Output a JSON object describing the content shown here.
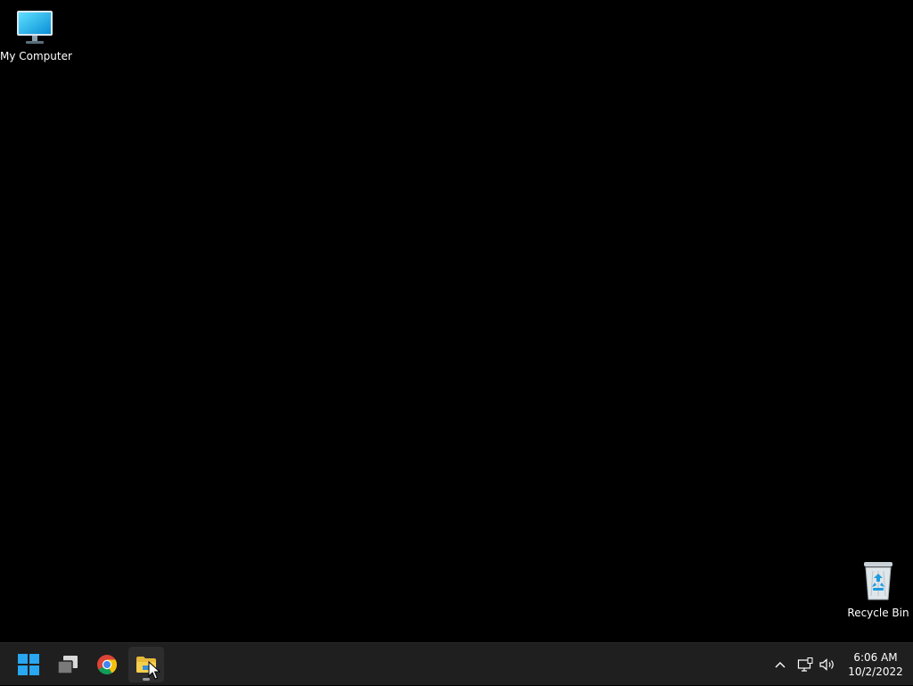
{
  "desktop": {
    "background_color": "#000000",
    "icons": [
      {
        "label": "My Computer",
        "icon": "monitor-icon"
      },
      {
        "label": "Recycle Bin",
        "icon": "recycle-bin-icon"
      }
    ]
  },
  "taskbar": {
    "background_color": "#1f1f1f",
    "apps": [
      {
        "name": "Start",
        "icon": "windows-logo-icon"
      },
      {
        "name": "Task View",
        "icon": "task-view-icon"
      },
      {
        "name": "Google Chrome",
        "icon": "chrome-icon"
      },
      {
        "name": "File Explorer",
        "icon": "folder-icon",
        "active": true
      }
    ],
    "tray": {
      "icons": [
        "chevron-up-icon",
        "network-icon",
        "volume-icon"
      ],
      "time": "6:06 AM",
      "date": "10/2/2022"
    }
  }
}
